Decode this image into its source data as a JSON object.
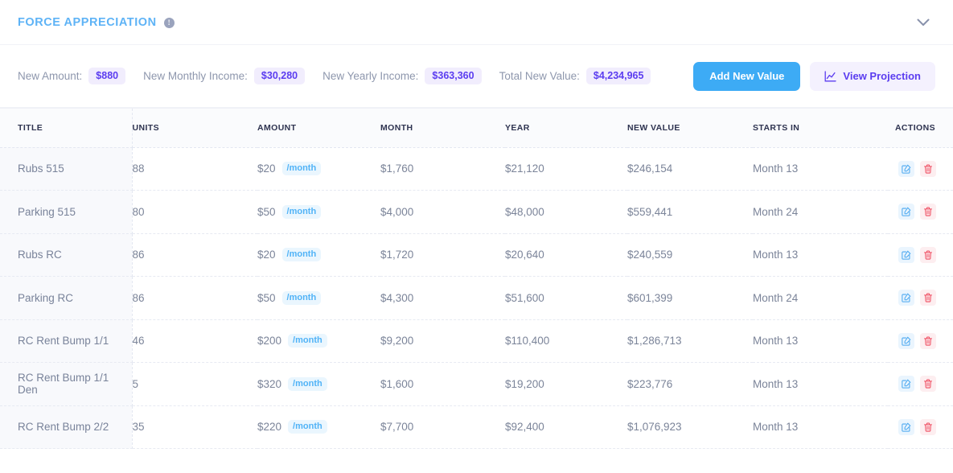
{
  "header": {
    "title": "FORCE APPRECIATION",
    "info_icon": "info-icon",
    "collapse_icon": "chevron-down-icon"
  },
  "summary": {
    "metrics": [
      {
        "label": "New Amount:",
        "value": "$880"
      },
      {
        "label": "New Monthly Income:",
        "value": "$30,280"
      },
      {
        "label": "New Yearly Income:",
        "value": "$363,360"
      },
      {
        "label": "Total New Value:",
        "value": "$4,234,965"
      }
    ],
    "add_button": "Add New Value",
    "projection_button": "View Projection",
    "projection_icon": "line-chart-icon"
  },
  "table": {
    "columns": [
      "TITLE",
      "UNITS",
      "AMOUNT",
      "MONTH",
      "YEAR",
      "NEW VALUE",
      "STARTS IN",
      "ACTIONS"
    ],
    "period_badge": "/month",
    "edit_icon": "edit-icon",
    "delete_icon": "trash-icon",
    "rows": [
      {
        "title": "Rubs 515",
        "units": "88",
        "amount": "$20",
        "month": "$1,760",
        "year": "$21,120",
        "new_value": "$246,154",
        "starts_in": "Month 13"
      },
      {
        "title": "Parking 515",
        "units": "80",
        "amount": "$50",
        "month": "$4,000",
        "year": "$48,000",
        "new_value": "$559,441",
        "starts_in": "Month 24"
      },
      {
        "title": "Rubs RC",
        "units": "86",
        "amount": "$20",
        "month": "$1,720",
        "year": "$20,640",
        "new_value": "$240,559",
        "starts_in": "Month 13"
      },
      {
        "title": "Parking RC",
        "units": "86",
        "amount": "$50",
        "month": "$4,300",
        "year": "$51,600",
        "new_value": "$601,399",
        "starts_in": "Month 24"
      },
      {
        "title": "RC Rent Bump 1/1",
        "units": "46",
        "amount": "$200",
        "month": "$9,200",
        "year": "$110,400",
        "new_value": "$1,286,713",
        "starts_in": "Month 13"
      },
      {
        "title": "RC Rent Bump 1/1 Den",
        "units": "5",
        "amount": "$320",
        "month": "$1,600",
        "year": "$19,200",
        "new_value": "$223,776",
        "starts_in": "Month 13"
      },
      {
        "title": "RC Rent Bump 2/2",
        "units": "35",
        "amount": "$220",
        "month": "$7,700",
        "year": "$92,400",
        "new_value": "$1,076,923",
        "starts_in": "Month 13"
      }
    ]
  },
  "colors": {
    "title_blue": "#5eb3f6",
    "accent_purple": "#5b3df0",
    "primary_button": "#3dabf5",
    "badge_blue": "#51b3f7",
    "delete_red": "#ef4a5e"
  }
}
